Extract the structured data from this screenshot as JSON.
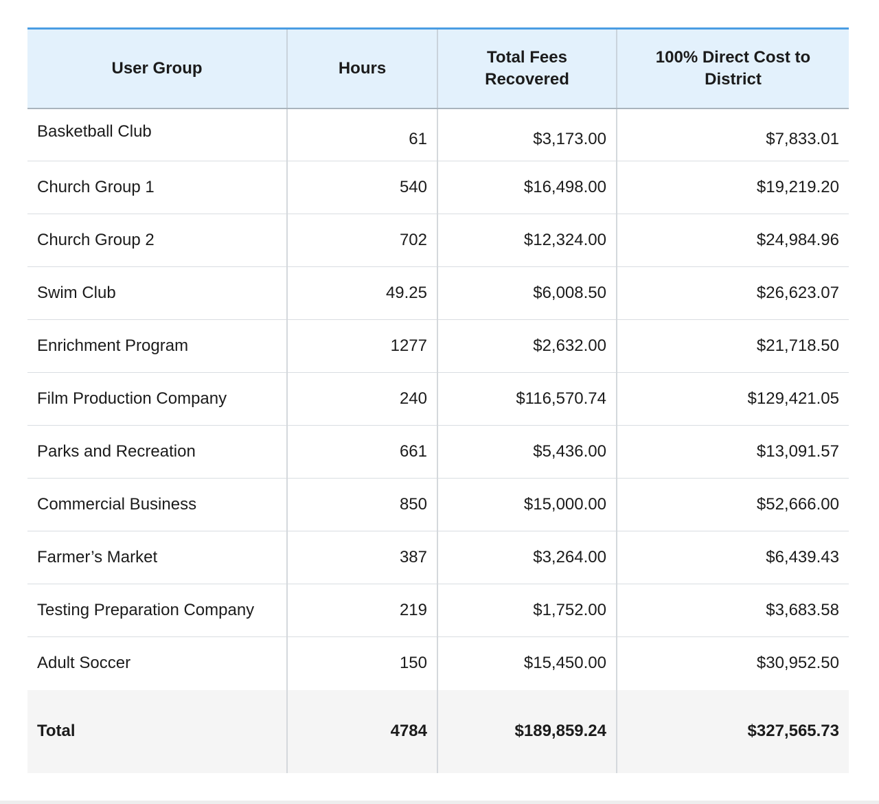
{
  "table": {
    "headers": [
      "User Group",
      "Hours",
      "Total Fees Recovered",
      "100% Direct Cost to District"
    ],
    "rows": [
      [
        "Basketball Club",
        "61",
        "$3,173.00",
        "$7,833.01"
      ],
      [
        "Church Group 1",
        "540",
        "$16,498.00",
        "$19,219.20"
      ],
      [
        "Church Group 2",
        "702",
        "$12,324.00",
        "$24,984.96"
      ],
      [
        "Swim Club",
        "49.25",
        "$6,008.50",
        "$26,623.07"
      ],
      [
        "Enrichment Program",
        "1277",
        "$2,632.00",
        "$21,718.50"
      ],
      [
        "Film Production Company",
        "240",
        "$116,570.74",
        "$129,421.05"
      ],
      [
        "Parks and Recreation",
        "661",
        "$5,436.00",
        "$13,091.57"
      ],
      [
        "Commercial Business",
        "850",
        "$15,000.00",
        "$52,666.00"
      ],
      [
        "Farmer’s Market",
        "387",
        "$3,264.00",
        "$6,439.43"
      ],
      [
        "Testing Preparation Company",
        "219",
        "$1,752.00",
        "$3,683.58"
      ],
      [
        "Adult Soccer",
        "150",
        "$15,450.00",
        "$30,952.50"
      ]
    ],
    "total": [
      "Total",
      "4784",
      "$189,859.24",
      "$327,565.73"
    ]
  },
  "colors": {
    "header_bg": "#e3f1fc",
    "header_top_border": "#4a9de3",
    "total_bg": "#f5f5f5"
  }
}
